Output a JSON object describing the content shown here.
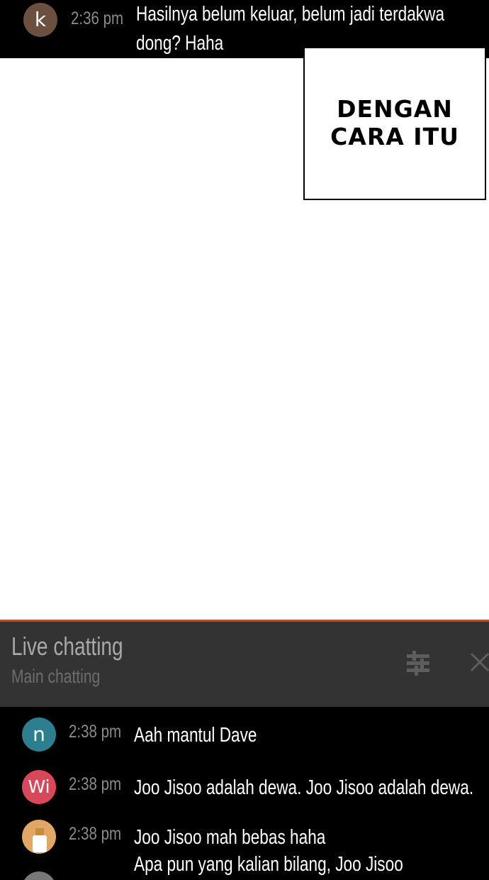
{
  "top_message": {
    "avatar_letter": "k",
    "avatar_color": "#6b4f3f",
    "time": "2:36 pm",
    "text": "Hasilnya belum keluar, belum jadi terdakwa dong? Haha"
  },
  "comic_panel": {
    "text": "DENGAN\nCARA ITU"
  },
  "live_chat": {
    "accent_color": "#e8401c",
    "title": "Live chatting",
    "subtitle": "Main chatting",
    "filter_icon": "sliders-icon",
    "close_icon": "close-icon",
    "messages": [
      {
        "avatar_letter": "n",
        "avatar_color": "#2b7f8e",
        "time": "2:38 pm",
        "text": "Aah mantul Dave"
      },
      {
        "avatar_letter": "Wi",
        "avatar_color": "#d9475a",
        "time": "2:38 pm",
        "text": "Joo Jisoo adalah dewa. Joo Jisoo adalah dewa."
      },
      {
        "avatar_letter": "",
        "avatar_color": "#e0a864",
        "time": "2:38 pm",
        "text": "Joo Jisoo mah bebas haha"
      },
      {
        "avatar_letter": "",
        "avatar_color": "#777777",
        "time": "",
        "text": "Apa pun yang kalian bilang, Joo Jisoo"
      }
    ]
  }
}
